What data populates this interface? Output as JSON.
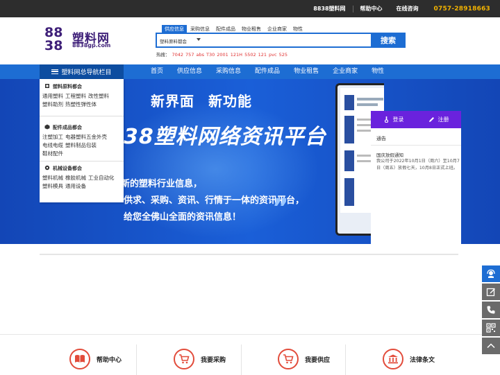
{
  "topbar": {
    "site_name": "8838塑料网",
    "help": "帮助中心",
    "consult": "在线咨询",
    "phone": "0757-28918663"
  },
  "logo": {
    "name": "塑料网",
    "url": "8838gp.com"
  },
  "search": {
    "tabs": [
      "供应信息",
      "采购信息",
      "配件成品",
      "物业租售",
      "企业商家",
      "物性"
    ],
    "active_tab": 0,
    "selected_category": "塑料原料都会",
    "button": "搜索",
    "hot_label": "热搜：",
    "hot_keywords": [
      "7042",
      "757",
      "abs",
      "T30",
      "2001",
      "121H",
      "5502",
      "121",
      "pvc",
      "525"
    ]
  },
  "nav": {
    "all_categories": "塑料网总导航栏目",
    "items": [
      "首页",
      "供应信息",
      "采购信息",
      "配件成品",
      "物业租售",
      "企业商家",
      "物性"
    ]
  },
  "categories": [
    {
      "title": "塑料原料都会",
      "rows": [
        [
          "通用塑料",
          "工程塑料",
          "改性塑料"
        ],
        [
          "塑料助剂",
          "热塑性弹性体"
        ]
      ]
    },
    {
      "title": "配件成品都会",
      "rows": [
        [
          "注塑加工",
          "电器塑料五金外壳"
        ],
        [
          "电线电缆",
          "塑料制品包装"
        ],
        [
          "鞋材配件"
        ]
      ]
    },
    {
      "title": "机械设备都会",
      "rows": [
        [
          "塑料机械",
          "橡胶机械",
          "工业自动化"
        ],
        [
          "塑料模具",
          "通用设备"
        ]
      ]
    }
  ],
  "banner": {
    "title_left": "新界面",
    "title_right": "新功能",
    "main": "38塑料网络资讯平台",
    "lines": [
      "新的塑料行业信息，",
      "供求、采购、资讯、行情于一体的资讯平台，",
      "给您全佛山全面的资讯信息！"
    ]
  },
  "account": {
    "login": "登录",
    "register": "注册",
    "notice_heading": "通告",
    "notice_title": "国庆放假通知",
    "notice_text": "我公司于2022年10月1日（周六）至10月7日（周五）放假七天，10月8日正式上班。"
  },
  "footer": {
    "items": [
      "帮助中心",
      "我要采购",
      "我要供应",
      "法律条文"
    ]
  },
  "colors": {
    "primary_blue": "#1d6dd3",
    "dark_nav": "#0d4da0",
    "purple": "#6a22dd",
    "phone_yellow": "#f4b400",
    "hot_red": "#e03030",
    "footer_red": "#e24b3a"
  }
}
